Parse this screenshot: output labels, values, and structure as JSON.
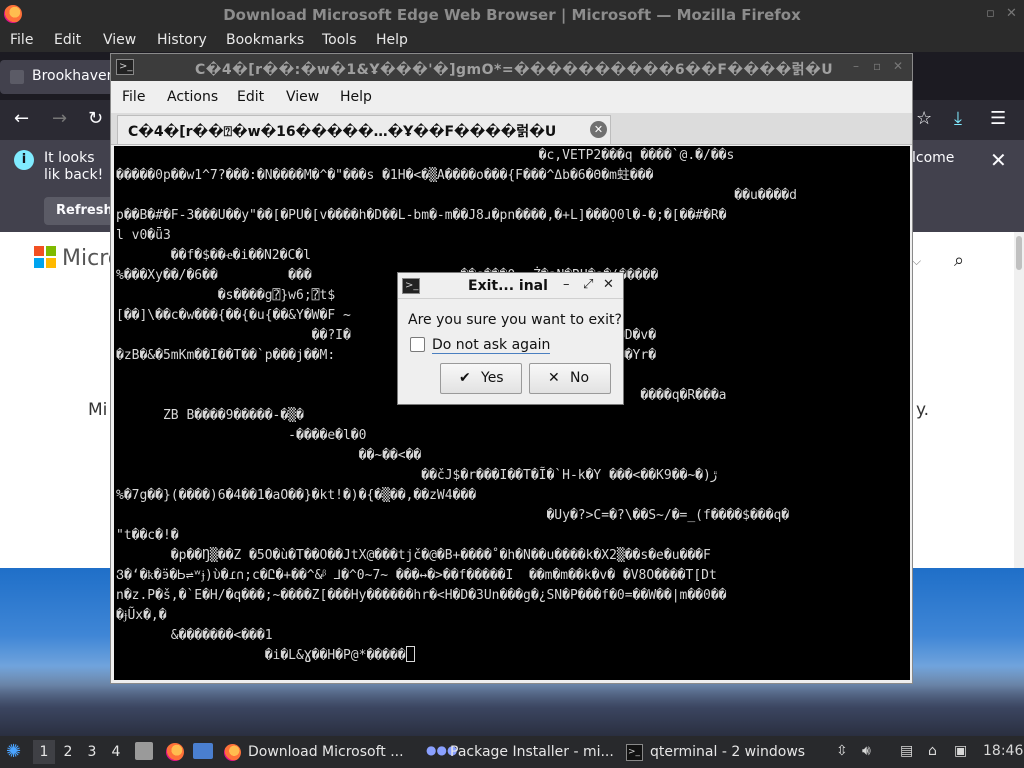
{
  "firefox": {
    "title": "Download Microsoft Edge Web Browser | Microsoft — Mozilla Firefox",
    "menu": [
      "File",
      "Edit",
      "View",
      "History",
      "Bookmarks",
      "Tools",
      "Help"
    ],
    "tab_label": "Brookhaven",
    "notification": {
      "message": "It looks lik back!",
      "refresh_label": "Refresh",
      "welcome_fragment": "lcome"
    },
    "page": {
      "brand_fragment": "Micro",
      "body_fragment_left": "Mi",
      "body_fragment_right": "y."
    }
  },
  "terminal": {
    "window_title": "C�4�[r��:�w�1&Ұ���'�]gmO*=����������6��F����럵�U",
    "menu": [
      "File",
      "Actions",
      "Edit",
      "View",
      "Help"
    ],
    "tab_title": "C�4�[r��⍰�w�16�����…�Ұ��F����럵�U",
    "screen_lines": [
      "                                                      �c,VETP2���q ����`@.�/��s",
      "�����0p��w1^7?���:�N����M�^�\"���s �1H�<�▒A����o���{F���^Δb�6�Θ�m蛀���",
      "                                                                               ��u����d",
      "p��B�#�F-3���U��y\"��[�PU�[v����h�D��L-bm�-m��J8ɹ�pn����,�+L]���Ọ0l�-�;�[��#�R�",
      "l v0�ǖ3",
      "       ��f�$��ҽ�i��N2�C�l",
      "%���Xy��/�6��         ���                   ��s���0ᚔŻ�aN�ṚU�a�(�����",
      "             �s����g⍰}w6;⍰t$",
      "[��]\\��c�w���{��{�u{��&Y�W�F ~",
      "                         ��?I�               ▒�(sN�������*?��0���D�v�",
      "�zB�&�5mKm��I��T��`p���j��M:                 k�� �{S�[��X+�����e��Yr�",
      "                                              ��#騙�L��5o<}�6",
      "                                                                   ����q�R���a",
      "      ZB B����9�����-�▒�",
      "                      -����e�l�0",
      "                               ��~��<��",
      "                                       ��čJ$�r���I��T�Ĩ�`H-k�Y ���<��K9��~�)ڙ",
      "%�7g��}(����)6�4��1�aO��}�kt!�)�{�▒��,��zW4���",
      "                                                       �Uy�?>C=�?\\��S~/�=_(f����$���q�",
      "\"t��c�!�",
      "       �p��Ŋ▒��Z �5O�ù�T��O��JtX@���tjč�@�B+����˚�h�N��u����k�X2▒��s�e�u���F",
      "Ვ�ʻ�ҟ�ӭ�Ꮟ⇌ʷɉ)ὺ�ɾ∩;ϲ�Ը�+��^&ᵝ ⅃�^0~7~ ���↔�>��f�����I  ��m�m��k�v� �V8O����T[Dt",
      "n�z.P�š,�`E�H/�q���;~����Z[���Hy������hr�<H�D�3Un���g�¿SN�P���f�0=��W��|m��0��",
      "�ɉŨx�,�",
      "       &�������<���1",
      "                   �i�L&Ɣ��H�P@*�����"
    ]
  },
  "dialog": {
    "title": "Exit... inal",
    "question": "Are you sure you want to exit?",
    "checkbox_label": "Do not ask again",
    "checkbox_checked": false,
    "yes_label": "Yes",
    "no_label": "No"
  },
  "taskbar": {
    "workspaces": [
      "1",
      "2",
      "3",
      "4"
    ],
    "active_workspace": "1",
    "windows": [
      "Download Microsoft ...",
      "Package Installer - mi...",
      "qterminal - 2 windows"
    ],
    "clock": "18:46"
  },
  "colors": {
    "firefox_logo": "#ff7139",
    "download_accent": "#80ebff",
    "terminal_bg": "#000000",
    "taskbar_bg": "#28292c"
  }
}
